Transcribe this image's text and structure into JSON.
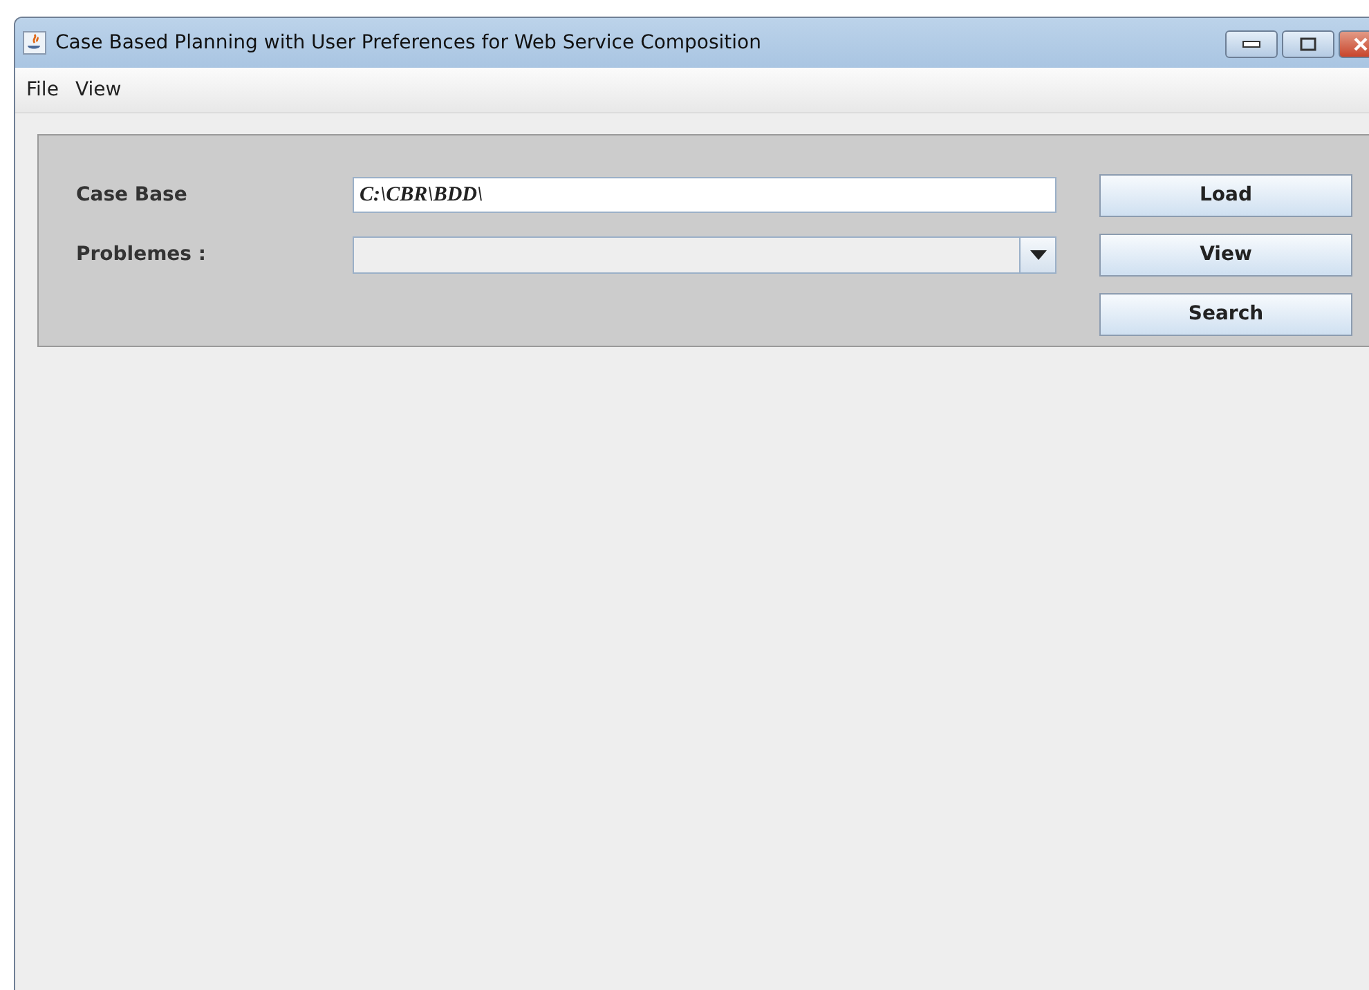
{
  "window": {
    "title": "Case Based Planning with User Preferences for Web Service Composition"
  },
  "menu": [
    "File",
    "View"
  ],
  "form": {
    "case_base": {
      "label": "Case Base",
      "value": "C:\\CBR\\BDD\\"
    },
    "problems": {
      "label": "Problemes :"
    }
  },
  "buttons": [
    "Load",
    "View",
    "Search"
  ]
}
